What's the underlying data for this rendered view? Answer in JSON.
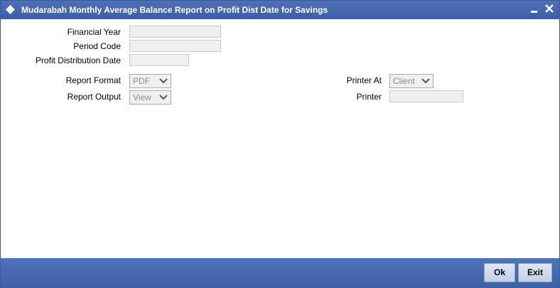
{
  "window": {
    "title": "Mudarabah Monthly Average Balance Report on Profit Dist Date for Savings"
  },
  "form": {
    "financial_year_label": "Financial Year",
    "financial_year_value": "",
    "period_code_label": "Period Code",
    "period_code_value": "",
    "profit_distribution_date_label": "Profit Distribution Date",
    "profit_distribution_date_value": "",
    "report_format_label": "Report Format",
    "report_format_value": "PDF",
    "report_output_label": "Report Output",
    "report_output_value": "View",
    "printer_at_label": "Printer At",
    "printer_at_value": "Client",
    "printer_label": "Printer",
    "printer_value": ""
  },
  "footer": {
    "ok_label": "Ok",
    "exit_label": "Exit"
  },
  "colors": {
    "title_bar": "#4566ad",
    "footer_bar": "#4566ad",
    "field_bg": "#f0f0f0"
  }
}
